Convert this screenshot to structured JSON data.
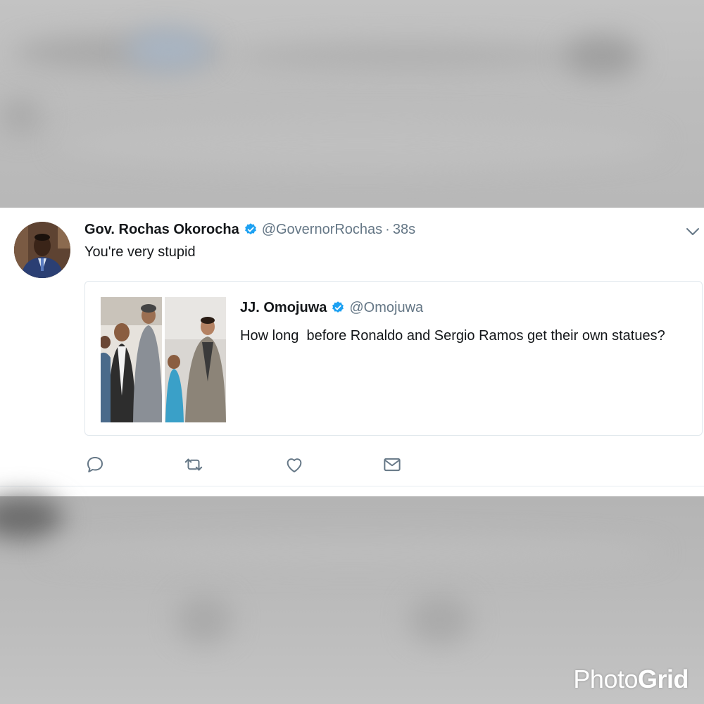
{
  "tweet": {
    "author_name": "Gov. Rochas Okorocha",
    "author_handle": "@GovernorRochas",
    "separator": "·",
    "timestamp": "38s",
    "text": "You're very stupid",
    "avatar_icon": "avatar-photo",
    "verified_icon": "verified-badge-icon",
    "menu_icon": "chevron-down-icon"
  },
  "quoted_tweet": {
    "author_name": "JJ. Omojuwa",
    "author_handle": "@Omojuwa",
    "verified_icon": "verified-badge-icon",
    "text": "How long  before Ronaldo and Sergio Ramos get their own statues?",
    "media_icon": "photo-collage"
  },
  "actions": [
    {
      "name": "reply",
      "icon": "reply-icon"
    },
    {
      "name": "retweet",
      "icon": "retweet-icon"
    },
    {
      "name": "like",
      "icon": "heart-icon"
    },
    {
      "name": "message",
      "icon": "envelope-icon"
    }
  ],
  "watermark": {
    "part1": "Photo",
    "part2": "Grid"
  },
  "colors": {
    "verified": "#1da1f2",
    "text_primary": "#14171a",
    "text_secondary": "#657786",
    "border": "#e1e8ed",
    "background_blur": "#b9b9b9"
  }
}
